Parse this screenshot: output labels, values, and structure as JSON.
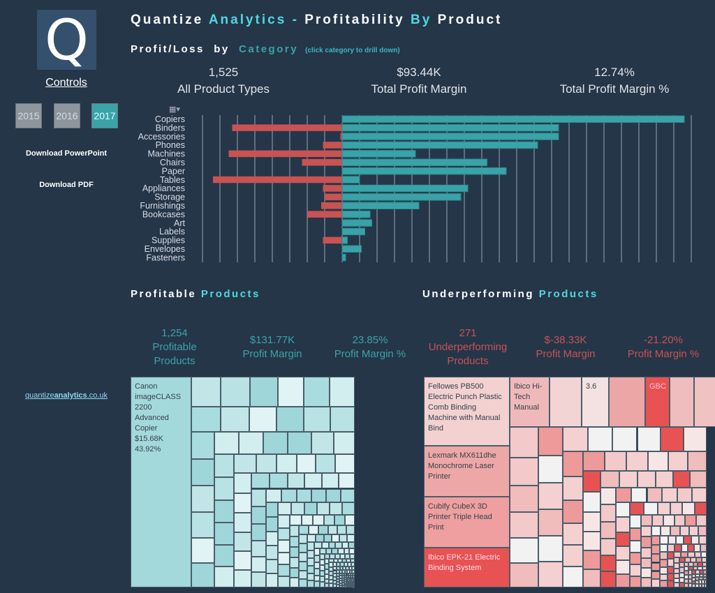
{
  "logo": {
    "letter": "Q"
  },
  "sidebar": {
    "controls_label": "Controls",
    "years": [
      {
        "label": "2015",
        "selected": false
      },
      {
        "label": "2016",
        "selected": false
      },
      {
        "label": "2017",
        "selected": true
      }
    ],
    "download_ppt": "Download PowerPoint",
    "download_pdf": "Download PDF",
    "site_link_a": "quantize",
    "site_link_b": "analytics",
    "site_link_c": ".co.uk"
  },
  "header": {
    "title_a": "Quantize",
    "title_b": "Analytics",
    "title_c": "-",
    "title_d": "Profitability",
    "title_e": "By",
    "title_f": "Product"
  },
  "section1": {
    "title_a": "Profit/Loss",
    "title_b": "by",
    "title_c": "Category",
    "hint": "(click category to drill down)"
  },
  "kpis": [
    {
      "value": "1,525",
      "label": "All Product Types"
    },
    {
      "value": "$93.44K",
      "label": "Total Profit Margin"
    },
    {
      "value": "12.74%",
      "label": "Total Profit Margin %"
    }
  ],
  "colors": {
    "background": "#253649",
    "profit": "#3aa3a8",
    "loss": "#c95252"
  },
  "chart_data": {
    "type": "bar",
    "orientation": "horizontal",
    "note_units": "gridline steps (axis unlabeled)",
    "categories": [
      "Copiers",
      "Binders",
      "Accessories",
      "Phones",
      "Machines",
      "Chairs",
      "Paper",
      "Tables",
      "Appliances",
      "Storage",
      "Furnishings",
      "Bookcases",
      "Art",
      "Labels",
      "Supplies",
      "Envelopes",
      "Fasteners"
    ],
    "series": [
      {
        "name": "Profit",
        "values": [
          19.6,
          12.4,
          12.4,
          11.2,
          4.2,
          8.3,
          9.4,
          1.0,
          7.2,
          6.8,
          4.4,
          1.6,
          1.7,
          1.3,
          0.3,
          1.1,
          0.2
        ]
      },
      {
        "name": "Loss",
        "values": [
          0,
          -6.3,
          -0.1,
          -1.1,
          -6.5,
          -2.3,
          0,
          -7.4,
          -1.1,
          -1.0,
          -1.2,
          -2.0,
          0,
          0,
          -1.1,
          0,
          0
        ]
      }
    ],
    "grid": true,
    "xlim": [
      -8,
      20
    ]
  },
  "profitable": {
    "title_a": "Profitable",
    "title_b": "Products",
    "kpis": [
      {
        "value": "1,254",
        "label": "Profitable Products"
      },
      {
        "value": "$131.77K",
        "label": "Profit Margin"
      },
      {
        "value": "23.85%",
        "label": "Profit Margin %"
      }
    ],
    "top_tile": {
      "name": "Canon imageCLASS 2200 Advanced Copier",
      "profit": "$15.68K",
      "margin": "43.92%"
    }
  },
  "underperforming": {
    "title_a": "Underperforming",
    "title_b": "Products",
    "kpis": [
      {
        "value": "271",
        "label": "Underperforming Products"
      },
      {
        "value": "$-38.33K",
        "label": "Profit Margin"
      },
      {
        "value": "-21.20%",
        "label": "Profit Margin %"
      }
    ],
    "tiles": [
      "Fellowes PB500 Electric Punch Plastic Comb Binding Machine with Manual Bind",
      "Lexmark MX611dhe Monochrome Laser Printer",
      "Cubify CubeX 3D Printer Triple Head Print",
      "Ibico EPK-21 Electric Binding System"
    ],
    "top_row": [
      "Ibico Hi-Tech Manual",
      "",
      "3.6",
      "",
      "GBC",
      "",
      ""
    ]
  }
}
